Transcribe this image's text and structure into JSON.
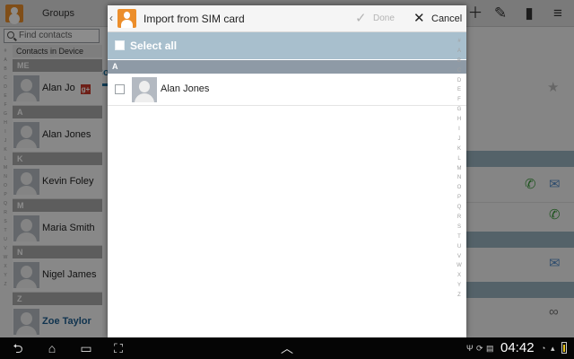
{
  "background_app": {
    "tabs": {
      "groups": "Groups",
      "contacts_partial": "Co"
    },
    "search_placeholder": "Find contacts",
    "subheader": "Contacts in Device",
    "index_letters_left": [
      "#",
      "A",
      "B",
      "C",
      "D",
      "E",
      "F",
      "G",
      "H",
      "I",
      "J",
      "K",
      "L",
      "M",
      "N",
      "O",
      "P",
      "Q",
      "R",
      "S",
      "T",
      "U",
      "V",
      "W",
      "X",
      "Y",
      "Z"
    ],
    "sections": [
      {
        "letter": "ME",
        "contacts": [
          {
            "name": "Alan Jo",
            "badge": "g+"
          }
        ]
      },
      {
        "letter": "A",
        "contacts": [
          {
            "name": "Alan Jones"
          }
        ]
      },
      {
        "letter": "K",
        "contacts": [
          {
            "name": "Kevin Foley"
          }
        ]
      },
      {
        "letter": "M",
        "contacts": [
          {
            "name": "Maria Smith"
          }
        ]
      },
      {
        "letter": "N",
        "contacts": [
          {
            "name": "Nigel James"
          }
        ]
      },
      {
        "letter": "Z",
        "contacts": [
          {
            "name": "Zoe Taylor",
            "selected": true
          }
        ]
      }
    ]
  },
  "dialog": {
    "title": "Import from SIM card",
    "done_label": "Done",
    "cancel_label": "Cancel",
    "select_all_label": "Select all",
    "section_letter": "A",
    "contact": {
      "name": "Alan Jones"
    },
    "index_letters": [
      "#",
      "A",
      "B",
      "C",
      "D",
      "E",
      "F",
      "G",
      "H",
      "I",
      "J",
      "K",
      "L",
      "M",
      "N",
      "O",
      "P",
      "Q",
      "R",
      "S",
      "T",
      "U",
      "V",
      "W",
      "X",
      "Y",
      "Z"
    ]
  },
  "system_bar": {
    "time": "04:42"
  },
  "colors": {
    "accent": "#1c6d9c",
    "select_all_bar": "#a8bfcd",
    "section_header": "#8e9aa6",
    "sim_icon": "#ec8e2b",
    "badge_red": "#c8392b"
  }
}
